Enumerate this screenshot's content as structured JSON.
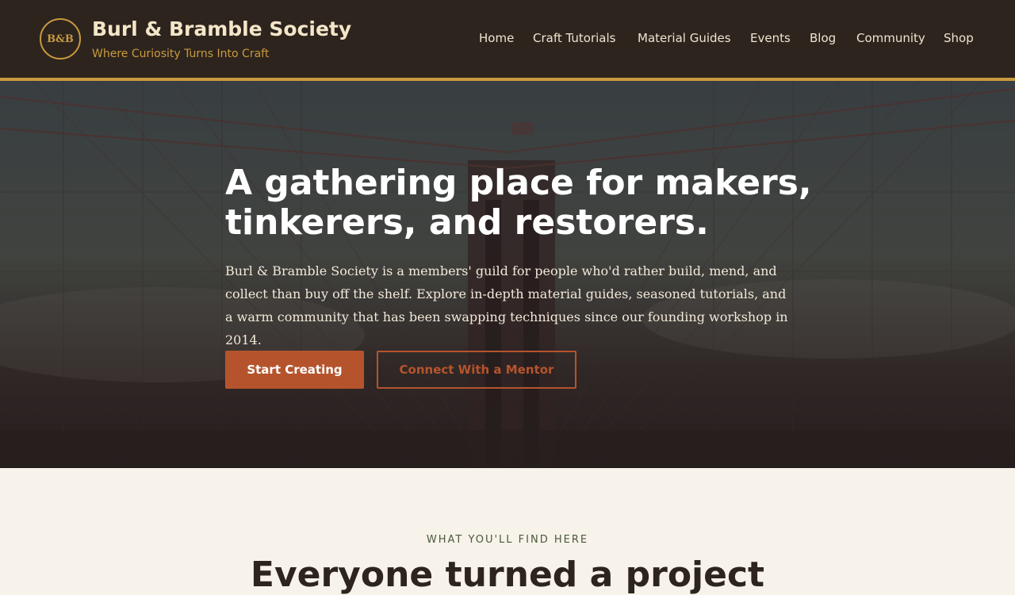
{
  "brand": {
    "logo_text": "B&B",
    "name": "Burl & Bramble Society",
    "tagline": "Where Curiosity Turns Into Craft"
  },
  "nav": {
    "items": [
      {
        "label": "Home"
      },
      {
        "label": "Craft Tutorials"
      },
      {
        "label": "Material Guides"
      },
      {
        "label": "Events"
      },
      {
        "label": "Blog"
      },
      {
        "label": "Community"
      },
      {
        "label": "Shop"
      }
    ]
  },
  "hero": {
    "title": "A gathering place for makers, tinkerers, and restorers.",
    "body": "Burl & Bramble Society is a members' guild for people who'd rather build, mend, and collect than buy off the shelf. Explore in-depth material guides, seasoned tutorials, and a warm community that has been swapping techniques since our founding workshop in 2014.",
    "primary_cta": "Start Creating",
    "secondary_cta": "Connect With a Mentor"
  },
  "features": {
    "eyebrow": "WHAT YOU'LL FIND HERE",
    "heading": "Everyone turned a project"
  },
  "colors": {
    "header_bg": "#2d241e",
    "accent_gold": "#c99a3f",
    "accent_rust": "#b5542c",
    "page_bg": "#f7f2ea"
  }
}
